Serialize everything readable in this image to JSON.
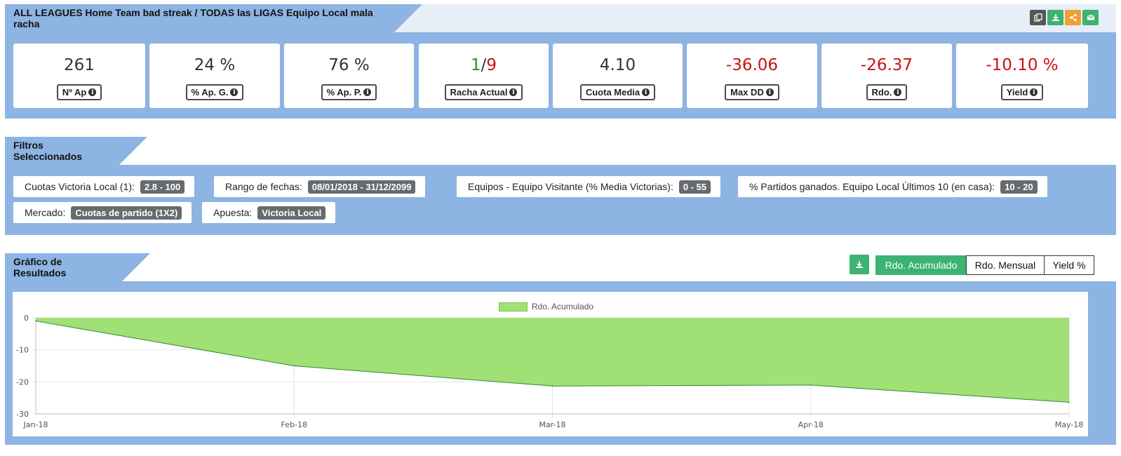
{
  "header": {
    "title": "ALL LEAGUES Home Team bad streak / TODAS las LIGAS Equipo Local mala racha",
    "icons": [
      "copy-icon",
      "download-icon",
      "share-icon",
      "email-icon"
    ]
  },
  "stats": [
    {
      "value": "261",
      "label": "Nº Ap",
      "color": "#333333"
    },
    {
      "value": "24 %",
      "label": "% Ap. G.",
      "color": "#333333"
    },
    {
      "value": "76 %",
      "label": "% Ap. P.",
      "color": "#333333"
    },
    {
      "value_win": "1",
      "value_sep": "/",
      "value_loss": "9",
      "label": "Racha Actual",
      "color_win": "#2e8b2e",
      "color_loss": "#cc1111"
    },
    {
      "value": "4.10",
      "label": "Cuota Media",
      "color": "#333333"
    },
    {
      "value": "-36.06",
      "label": "Max DD",
      "color": "#cc1111"
    },
    {
      "value": "-26.37",
      "label": "Rdo.",
      "color": "#cc1111"
    },
    {
      "value": "-10.10 %",
      "label": "Yield",
      "color": "#cc1111"
    }
  ],
  "filters_section": {
    "title": "Filtros Seleccionados",
    "items": [
      {
        "label": "Cuotas Victoria Local (1):",
        "value": "2.8 - 100"
      },
      {
        "label": "Rango de fechas:",
        "value": "08/01/2018 - 31/12/2099"
      },
      {
        "label": "Equipos - Equipo Visitante (% Media Victorias):",
        "value": "0 - 55"
      },
      {
        "label": "% Partidos ganados. Equipo Local Últimos 10 (en casa):",
        "value": "10 - 20"
      },
      {
        "label": "Mercado:",
        "value": "Cuotas de partido (1X2)"
      },
      {
        "label": "Apuesta:",
        "value": "Victoria Local"
      }
    ]
  },
  "results_section": {
    "title": "Gráfico de Resultados",
    "tabs": [
      {
        "label": "Rdo. Acumulado",
        "active": true
      },
      {
        "label": "Rdo. Mensual",
        "active": false
      },
      {
        "label": "Yield %",
        "active": false
      }
    ]
  },
  "chart_data": {
    "type": "area",
    "x": [
      "Jan-18",
      "Feb-18",
      "Mar-18",
      "Apr-18",
      "May-18"
    ],
    "series": [
      {
        "name": "Rdo. Acumulado",
        "values": [
          -1,
          -15,
          -21.3,
          -21,
          -26.37
        ],
        "color": "#a0e075",
        "line_color": "#2e8b2e"
      }
    ],
    "yticks": [
      0,
      -10,
      -20,
      -30
    ],
    "ylim": [
      -30,
      0
    ],
    "legend": "top-center",
    "grid": true
  }
}
